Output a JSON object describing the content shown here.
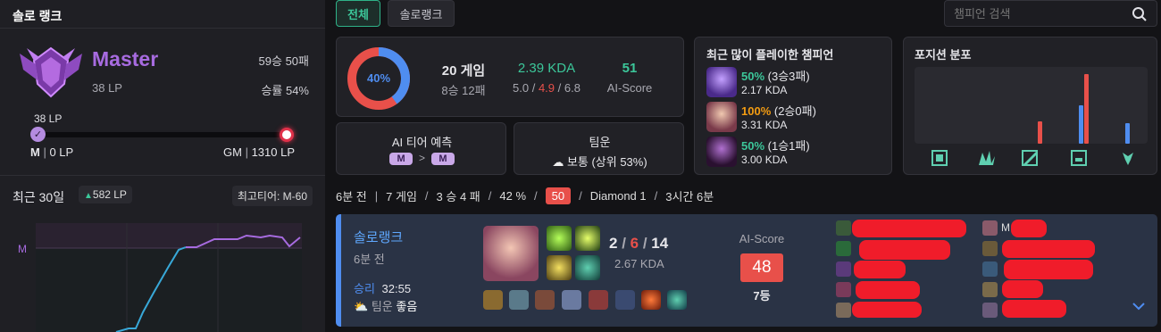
{
  "sidebar": {
    "title": "솔로 랭크",
    "tier_name": "Master",
    "lp": "38 LP",
    "record": "59승 50패",
    "winrate": "승률 54%",
    "progress_label": "38 LP",
    "progress_start_tier": "M",
    "progress_start_lp": "0 LP",
    "progress_end_tier": "GM",
    "progress_end_lp": "1310 LP",
    "progress_fraction": 0.029,
    "recent_label": "최근 30일",
    "recent_change": "▲582 LP",
    "peak_label": "최고티어: M-60",
    "graph_tier_label": "M"
  },
  "tabs": {
    "all": "전체",
    "solo": "솔로랭크"
  },
  "search": {
    "placeholder": "챔피언 검색"
  },
  "summary": {
    "winrate_pct": 40,
    "donut_label": "40%",
    "games": "20 게임",
    "wl": "8승 12패",
    "kda": "2.39 KDA",
    "kda_kill": "5.0",
    "kda_death": "4.9",
    "kda_assist": "6.8",
    "kda_sep": " / ",
    "ai_score": "51",
    "ai_label": "AI-Score"
  },
  "ai_tier": {
    "title": "AI 티어 예측",
    "from": "M",
    "arrow": ">",
    "to": "M"
  },
  "luck": {
    "title": "팀운",
    "value": "보통 (상위 53%)"
  },
  "champions": {
    "title": "최근 많이 플레이한 챔피언",
    "items": [
      {
        "pct": "50%",
        "record": " (3승3패)",
        "kda": "2.17 KDA",
        "color": "#3cc79a"
      },
      {
        "pct": "100%",
        "record": " (2승0패)",
        "kda": "3.31 KDA",
        "color": "#f39c12"
      },
      {
        "pct": "50%",
        "record": " (1승1패)",
        "kda": "3.00 KDA",
        "color": "#3cc79a"
      }
    ]
  },
  "positions": {
    "title": "포지션 분포",
    "icons": [
      "top-icon",
      "jungle-icon",
      "mid-icon",
      "bottom-icon",
      "support-icon"
    ],
    "blue_fraction": [
      0,
      0,
      0,
      0.55,
      0.3
    ],
    "red_fraction": [
      0,
      0,
      0.32,
      1.0,
      0
    ],
    "blue_color": "#4f8df0",
    "red_color": "#e8504a"
  },
  "filter_bar": {
    "time": "6분 전",
    "games": "7 게임",
    "wl": "3 승 4 패",
    "winrate": "42 %",
    "score": "50",
    "tier": "Diamond 1",
    "duration": "3시간 6분"
  },
  "match": {
    "queue": "솔로랭크",
    "time": "6분 전",
    "result": "승리",
    "duration": "32:55",
    "luck": "팀운",
    "luck_value": "좋음",
    "kills": "2",
    "deaths": "6",
    "assists": "14",
    "kda": "2.67 KDA",
    "ai_label": "AI-Score",
    "ai_score": "48",
    "rank": "7등",
    "right_visible_name": "M"
  }
}
